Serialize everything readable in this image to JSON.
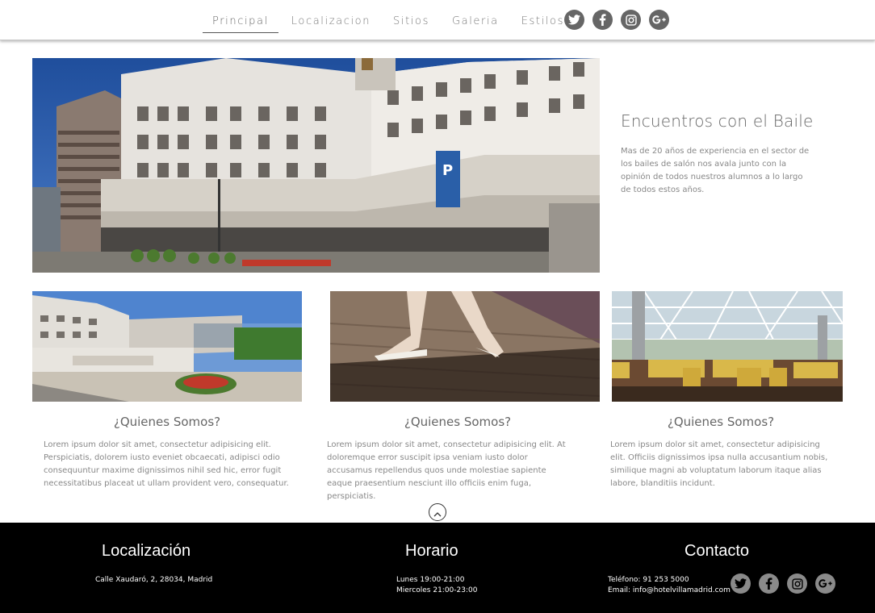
{
  "nav": {
    "items": [
      "Principal",
      "Localizacion",
      "Sitios",
      "Galeria",
      "Estilos"
    ],
    "active": "Principal"
  },
  "social": {
    "twitter": "t",
    "facebook": "f",
    "instagram": "◎",
    "googleplus": "g+"
  },
  "hero": {
    "title": "Encuentros con el Baile",
    "description": "Mas de 20 años de experiencia en el sector de los bailes de salón nos avala junto con la opinión de todos nuestros alumnos a lo largo de todos estos años.",
    "image_icon": "hotel-building-photo"
  },
  "cards": [
    {
      "title": "¿Quienes Somos?",
      "text": "Lorem ipsum dolor sit amet, consectetur adipisicing elit. Perspiciatis, dolorem iusto eveniet obcaecati, adipisci odio consequuntur maxime dignissimos nihil sed hic, error fugit necessitatibus placeat ut ullam provident vero, consequatur.",
      "image_icon": "hotel-entrance-photo"
    },
    {
      "title": "¿Quienes Somos?",
      "text": "Lorem ipsum dolor sit amet, consectetur adipisicing elit. At doloremque error suscipit ipsa veniam iusto dolor accusamus repellendus quos unde molestiae sapiente eaque praesentium nesciunt illo officiis enim fuga, perspiciatis.",
      "image_icon": "dancer-feet-photo"
    },
    {
      "title": "¿Quienes Somos?",
      "text": "Lorem ipsum dolor sit amet, consectetur adipisicing elit. Officiis dignissimos ipsa nulla accusantium nobis, similique magni ab voluptatum laborum itaque alias labore, blanditiis incidunt.",
      "image_icon": "banquet-hall-photo"
    }
  ],
  "footer": {
    "location": {
      "title": "Localización",
      "address": "Calle Xaudaró, 2, 28034, Madrid"
    },
    "schedule": {
      "title": "Horario",
      "line1": "Lunes 19:00-21:00",
      "line2": "Miercoles 21:00-23:00"
    },
    "contact": {
      "title": "Contacto",
      "phone": "Teléfono: 91 253 5000",
      "email": "Email: info@hotelvillamadrid.com"
    }
  },
  "colors": {
    "text_dark": "#666666",
    "text_light": "#888888",
    "footer_bg": "#000000",
    "social_icon": "#666666"
  }
}
